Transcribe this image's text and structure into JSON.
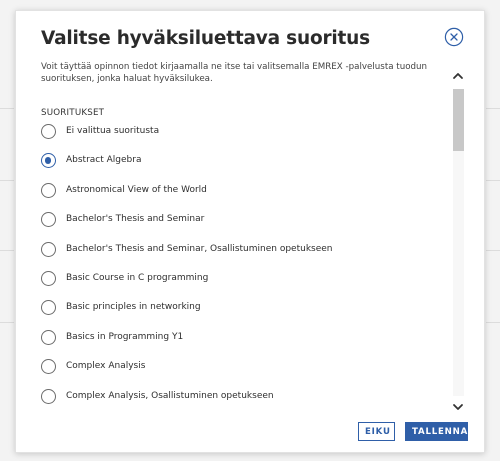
{
  "dialog": {
    "title": "Valitse hyväksiluettava suoritus",
    "intro": "Voit täyttää opinnon tiedot kirjaamalla ne itse tai valitsemalla EMREX -palvelusta tuodun suorituksen, jonka haluat hyväksilukea.",
    "section_label": "SUORITUKSET",
    "selected_index": 1,
    "options": [
      "Ei valittua suoritusta",
      "Abstract Algebra",
      "Astronomical View of the World",
      "Bachelor's Thesis and Seminar",
      "Bachelor's Thesis and Seminar, Osallistuminen opetukseen",
      "Basic Course in C programming",
      "Basic principles in networking",
      "Basics in Programming Y1",
      "Complex Analysis",
      "Complex Analysis, Osallistuminen opetukseen"
    ],
    "scroll_position_fraction": 0.0,
    "cancel_label": "EIKU",
    "save_label": "TALLENNA",
    "close_icon": "close-circle-icon",
    "scroll_up_icon": "chevron-up-icon",
    "scroll_down_icon": "chevron-down-icon"
  },
  "colors": {
    "accent": "#2f5fa8",
    "title_text": "#2b2b2b",
    "body_text": "#444444",
    "backdrop": "#f3f3f3"
  }
}
